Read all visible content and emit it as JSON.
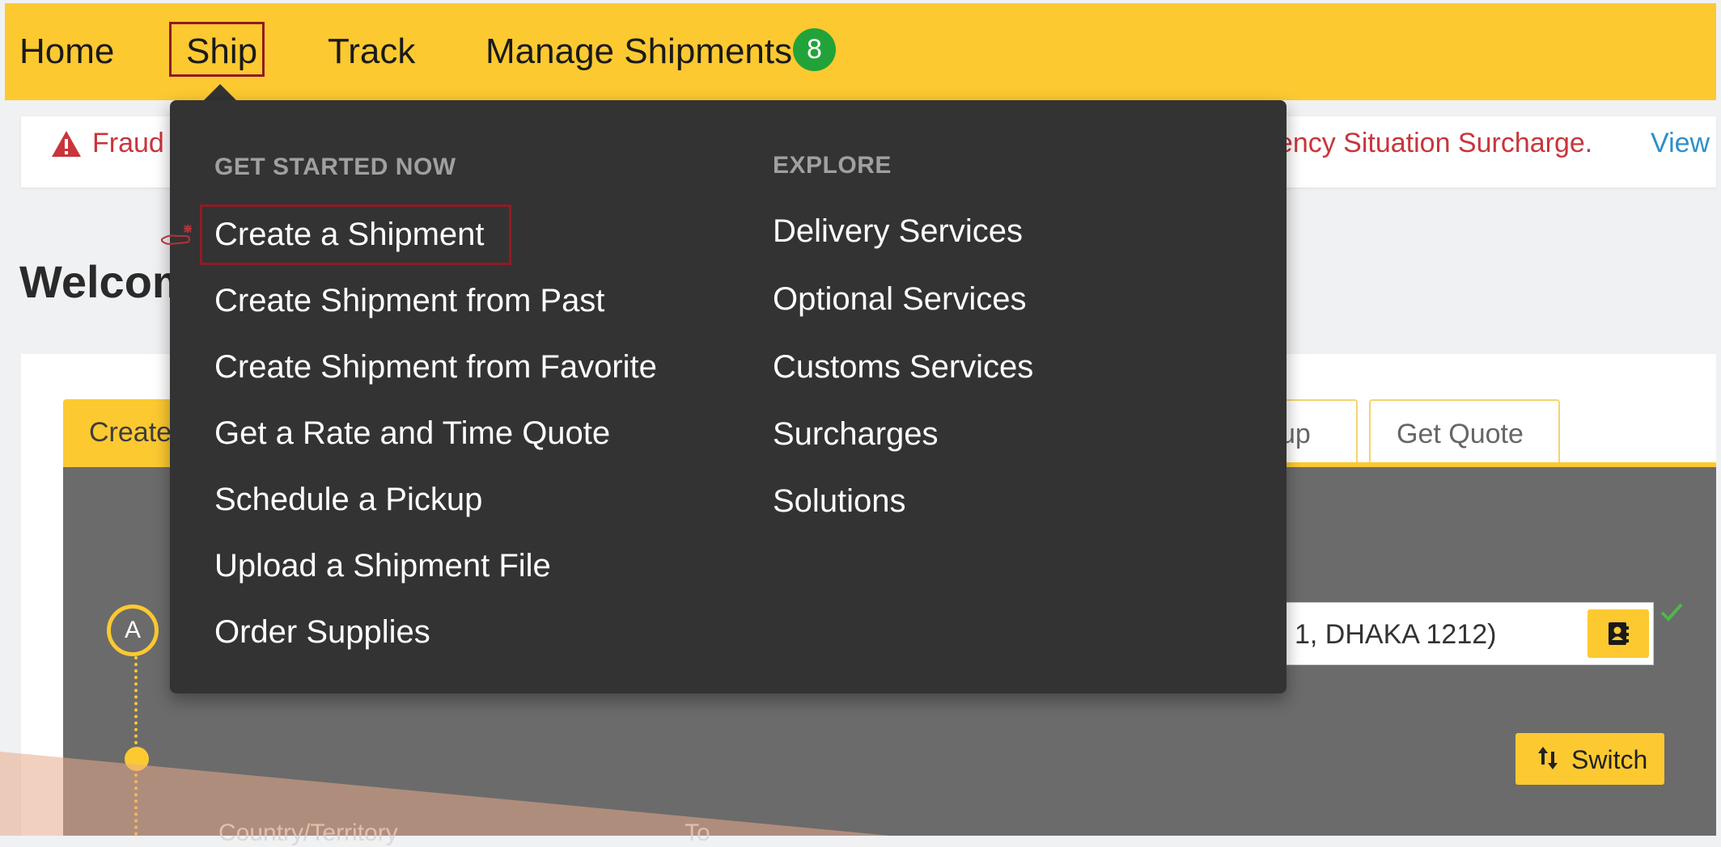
{
  "nav": {
    "items": [
      "Home",
      "Ship",
      "Track",
      "Manage Shipments"
    ],
    "badge_count": "8",
    "overflow": "'"
  },
  "alert": {
    "icon": "warning-triangle-icon",
    "text_left": "Fraud",
    "text_right": "gency Situation Surcharge.",
    "link": "View"
  },
  "welcome": "Welcom",
  "tabs": {
    "create": "Create",
    "pickup": "kup",
    "quote": "Get Quote"
  },
  "form": {
    "step_label": "A",
    "address_value": "1, DHAKA 1212)",
    "switch_label": "Switch",
    "field_label_1": "Country/Territory",
    "field_label_2": "To"
  },
  "dropdown": {
    "get_started": {
      "heading": "GET STARTED NOW",
      "items": [
        "Create a Shipment",
        "Create Shipment from Past",
        "Create Shipment from Favorite",
        "Get a Rate and Time Quote",
        "Schedule a Pickup",
        "Upload a Shipment File",
        "Order Supplies"
      ]
    },
    "explore": {
      "heading": "EXPLORE",
      "items": [
        "Delivery Services",
        "Optional Services",
        "Customs Services",
        "Surcharges",
        "Solutions"
      ]
    }
  },
  "colors": {
    "brand_yellow": "#fcc931",
    "dropdown_bg": "#333333",
    "highlight_border": "#8f1b24",
    "badge_green": "#22a339",
    "alert_red": "#c9353b",
    "link_blue": "#2e8fc9"
  }
}
